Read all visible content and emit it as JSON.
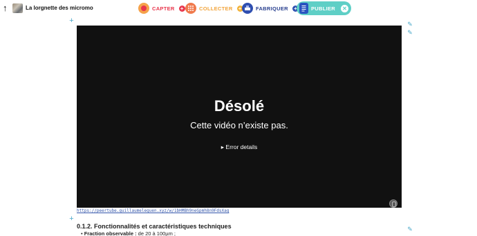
{
  "header": {
    "back_icon": "arrow-up-icon",
    "project_title": "La lorgnette des micromo",
    "steps": [
      {
        "id": "capter",
        "label": "CAPTER",
        "add": "+"
      },
      {
        "id": "collecter",
        "label": "COLLECTER",
        "add": "+"
      },
      {
        "id": "fabriquer",
        "label": "FABRIQUER",
        "add": "+"
      },
      {
        "id": "publier",
        "label": "PUBLIER",
        "close": "✕"
      }
    ],
    "colors": {
      "capter": "#e8364c",
      "collecter": "#f2a43a",
      "fabriquer": "#283f8f",
      "publier": "#5fcfc6"
    }
  },
  "video": {
    "title": "Désolé",
    "message": "Cette vidéo n’existe pas.",
    "details": "▸ Error details",
    "link": "https://peertube.guillaumeleguen.xyz/w/1bHMBh9neGpmh8n9FdsXag"
  },
  "content": {
    "section_title": "0.1.2. Fonctionnalités et caractéristiques techniques",
    "bullet_label": "Fraction observable :",
    "bullet_value": " de 20 à 100µm ;"
  },
  "icons": {
    "add": "+",
    "edit": "✎"
  }
}
